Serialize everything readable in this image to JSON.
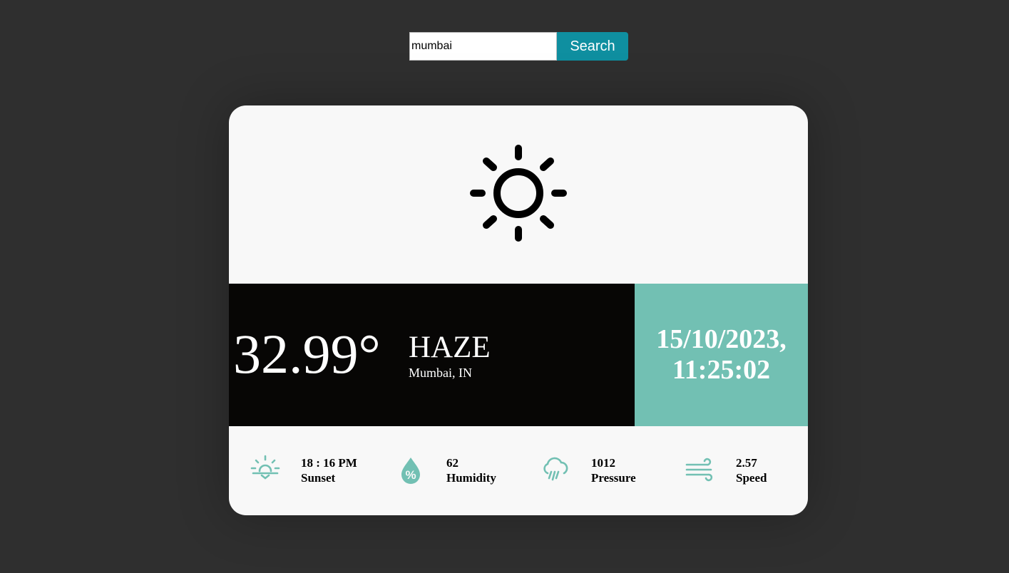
{
  "search": {
    "value": "mumbai",
    "button_label": "Search"
  },
  "weather": {
    "icon": "sun-icon",
    "temperature": "32.99°",
    "condition": "HAZE",
    "location": "Mumbai, IN",
    "date": "15/10/2023,",
    "time": "11:25:02"
  },
  "stats": [
    {
      "icon": "sunset-icon",
      "value": "18 : 16 PM",
      "label": "Sunset"
    },
    {
      "icon": "humidity-icon",
      "value": "62",
      "label": "Humidity"
    },
    {
      "icon": "rain-cloud-icon",
      "value": "1012",
      "label": "Pressure"
    },
    {
      "icon": "wind-icon",
      "value": "2.57",
      "label": "Speed"
    }
  ],
  "colors": {
    "page_background": "#2f2f2f",
    "card_background": "#f8f8f8",
    "dark_band": "#070605",
    "accent_teal": "#72c0b3",
    "search_button": "#0f8fa0"
  }
}
